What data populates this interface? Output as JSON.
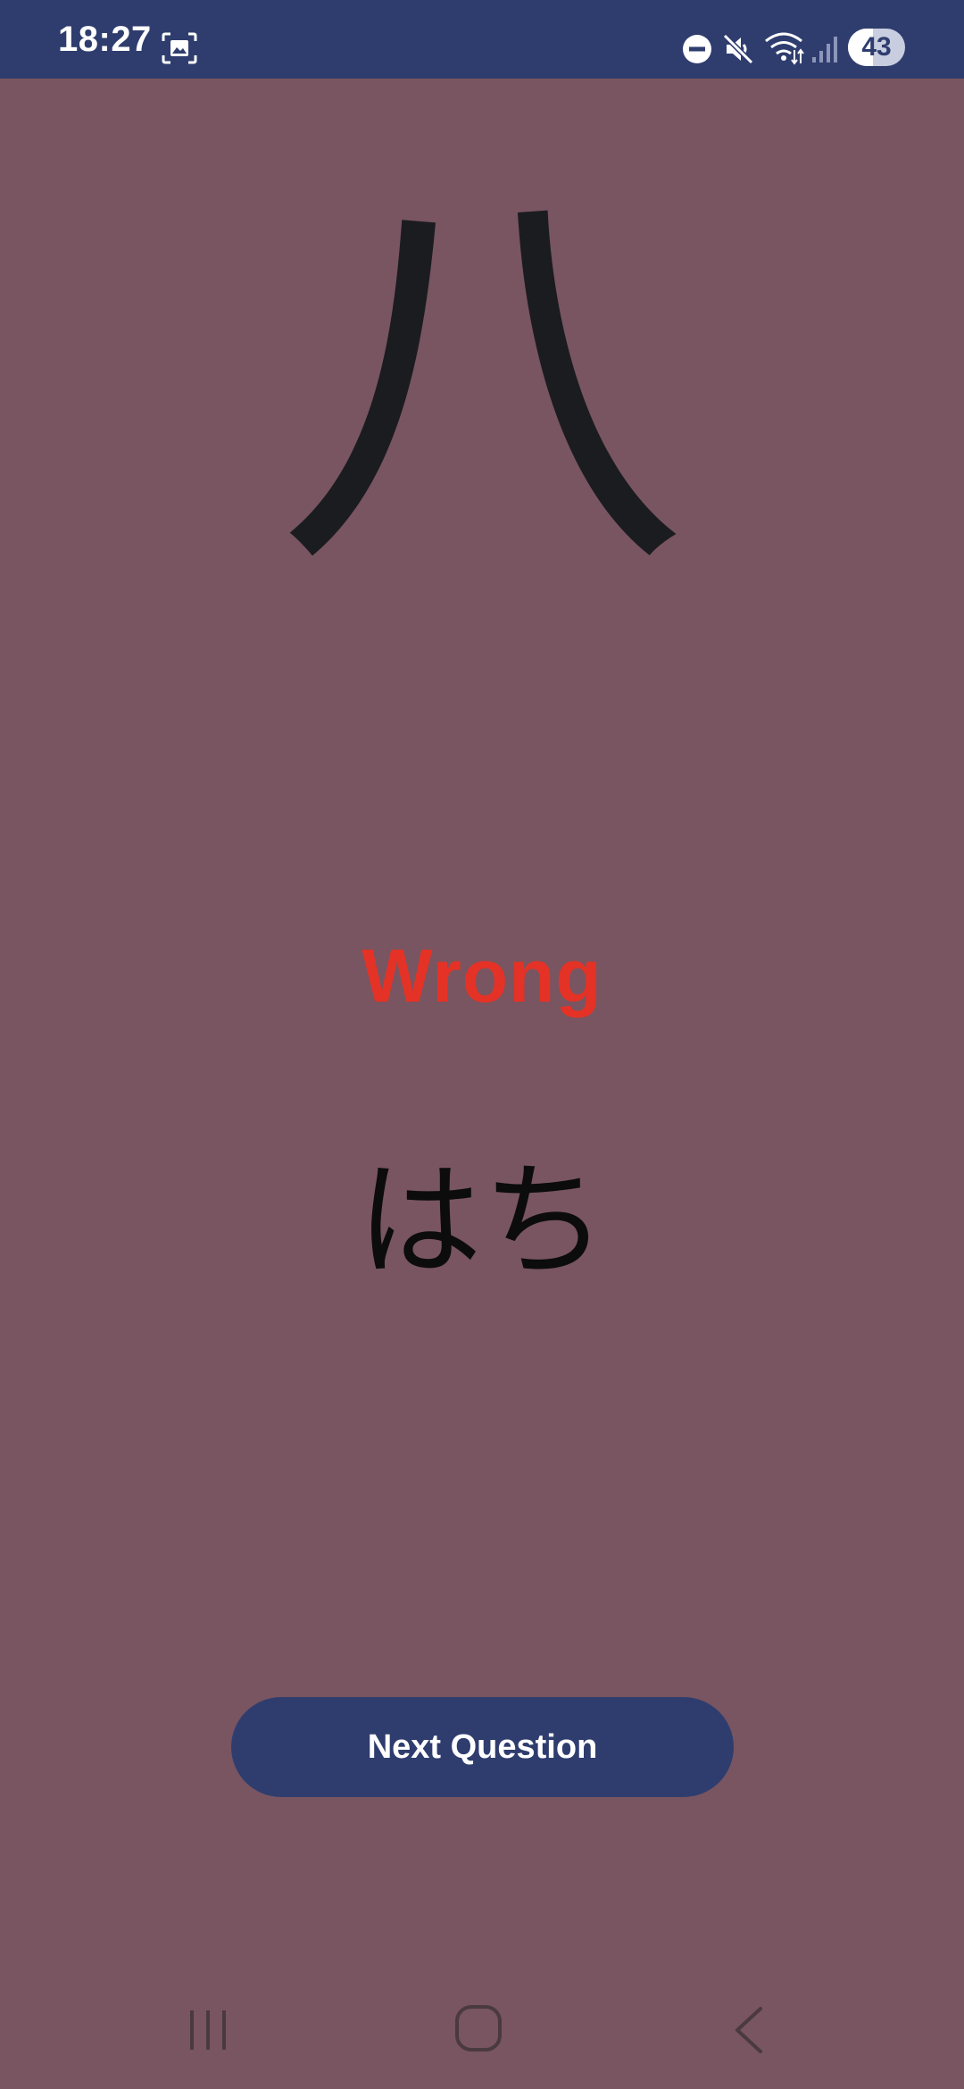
{
  "status_bar": {
    "time": "18:27",
    "battery_level": "43",
    "battery_percent": 43,
    "icons": [
      "screenshot-icon",
      "do-not-disturb-icon",
      "mute-icon",
      "wifi-icon",
      "signal-icon",
      "battery-icon"
    ]
  },
  "quiz": {
    "character": "八",
    "result_label": "Wrong",
    "reading": "はち",
    "next_button_label": "Next Question"
  },
  "nav_bar": {
    "icons": [
      "recents-icon",
      "home-icon",
      "back-icon"
    ]
  },
  "colors": {
    "background": "#785560",
    "accent": "#2f3d6e",
    "wrong": "#e53226"
  }
}
